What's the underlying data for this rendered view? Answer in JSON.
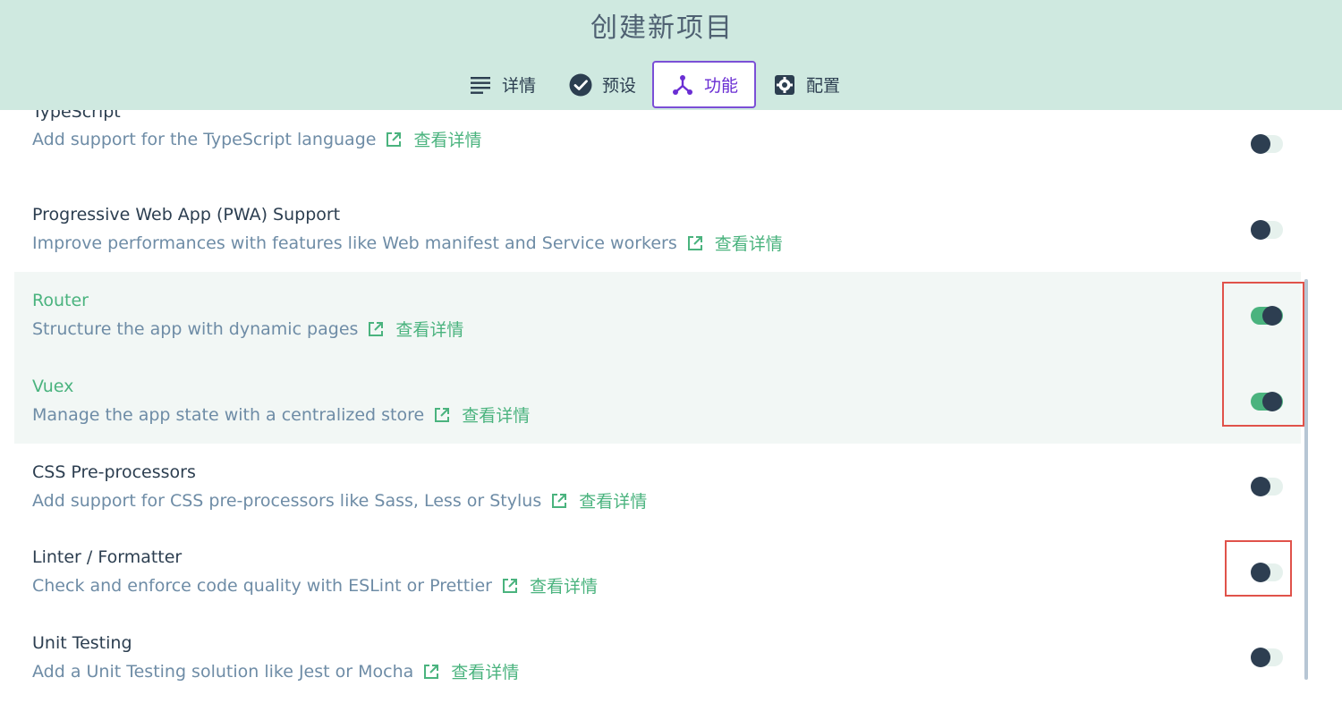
{
  "header": {
    "title": "创建新项目",
    "tabs": [
      {
        "label": "详情",
        "icon": "list-icon",
        "active": false
      },
      {
        "label": "预设",
        "icon": "check-circle-icon",
        "active": false
      },
      {
        "label": "功能",
        "icon": "fork-icon",
        "active": true
      },
      {
        "label": "配置",
        "icon": "gear-icon",
        "active": false
      }
    ]
  },
  "colors": {
    "header_bg": "#cfe9e0",
    "accent_green": "#4ab37e",
    "active_tab": "#6a2ed3",
    "highlight_red": "#e0524a"
  },
  "features": [
    {
      "name": "TypeScript",
      "description": "Add support for the TypeScript language",
      "more_label": "查看详情",
      "enabled": false
    },
    {
      "name": "Progressive Web App (PWA) Support",
      "description": "Improve performances with features like Web manifest and Service workers",
      "more_label": "查看详情",
      "enabled": false
    },
    {
      "name": "Router",
      "description": "Structure the app with dynamic pages",
      "more_label": "查看详情",
      "enabled": true
    },
    {
      "name": "Vuex",
      "description": "Manage the app state with a centralized store",
      "more_label": "查看详情",
      "enabled": true
    },
    {
      "name": "CSS Pre-processors",
      "description": "Add support for CSS pre-processors like Sass, Less or Stylus",
      "more_label": "查看详情",
      "enabled": false
    },
    {
      "name": "Linter / Formatter",
      "description": "Check and enforce code quality with ESLint or Prettier",
      "more_label": "查看详情",
      "enabled": false
    },
    {
      "name": "Unit Testing",
      "description": "Add a Unit Testing solution like Jest or Mocha",
      "more_label": "查看详情",
      "enabled": false
    }
  ]
}
